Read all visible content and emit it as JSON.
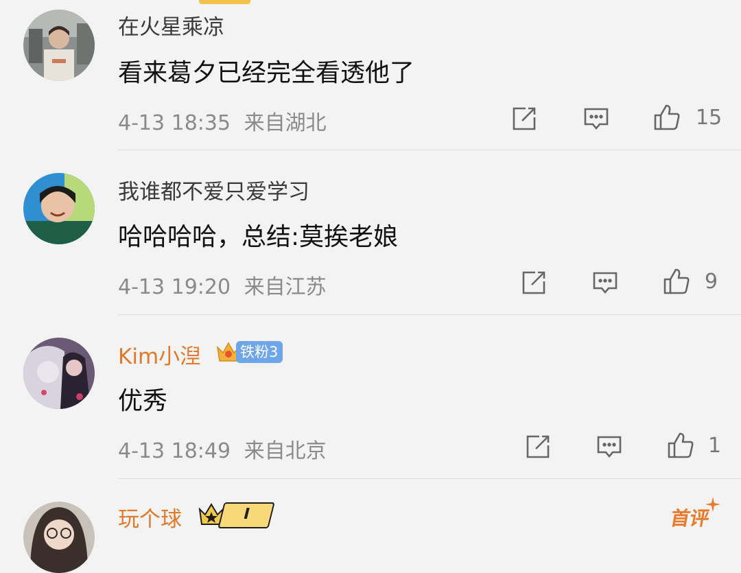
{
  "comments": [
    {
      "username": "在火星乘凉",
      "content": "看来葛夕已经完全看透他了",
      "time": "4-13 18:35",
      "location": "来自湖北",
      "likes": "15"
    },
    {
      "username": "我谁都不爱只爱学习",
      "content": "哈哈哈哈，总结:莫挨老娘",
      "time": "4-13 19:20",
      "location": "来自江苏",
      "likes": "9"
    },
    {
      "username": "Kim小湼",
      "fan_badge": "铁粉3",
      "content": "优秀",
      "time": "4-13 18:49",
      "location": "来自北京",
      "likes": "1"
    },
    {
      "username": "玩个球",
      "rank_badge": "I",
      "first_comment_label": "首评"
    }
  ],
  "icons": {
    "share": "share-icon",
    "reply": "comment-icon",
    "like": "thumbs-up-icon"
  },
  "colors": {
    "background": "#f3f3f3",
    "vip_name": "#e0792b",
    "fan_badge": "#6fa6ea",
    "first_comment": "#e87a2a"
  }
}
